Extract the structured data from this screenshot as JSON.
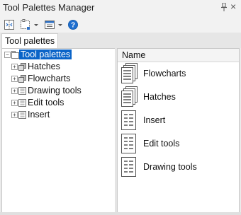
{
  "window": {
    "title": "Tool Palettes Manager",
    "pin_glyph": "⚓",
    "close_glyph": "×"
  },
  "toolbar": {
    "buttons": [
      {
        "name": "new-palette-icon",
        "dropdown": false
      },
      {
        "name": "import-icon",
        "dropdown": true
      },
      {
        "name": "view-options-icon",
        "dropdown": true
      },
      {
        "name": "help-icon",
        "dropdown": false
      }
    ],
    "help_glyph": "?"
  },
  "tabs": [
    {
      "label": "Tool palettes",
      "active": true
    }
  ],
  "tree": {
    "root": {
      "label": "Tool palettes",
      "expander": "−",
      "selected": true
    },
    "children": [
      {
        "label": "Hatches",
        "expander": "+",
        "icon": "stacked-palette-icon"
      },
      {
        "label": "Flowcharts",
        "expander": "+",
        "icon": "stacked-palette-icon"
      },
      {
        "label": "Drawing tools",
        "expander": "+",
        "icon": "palette-icon"
      },
      {
        "label": "Edit tools",
        "expander": "+",
        "icon": "palette-icon"
      },
      {
        "label": "Insert",
        "expander": "+",
        "icon": "palette-icon"
      }
    ]
  },
  "list": {
    "column_header": "Name",
    "items": [
      {
        "label": "Flowcharts",
        "icon": "stacked-palette-icon"
      },
      {
        "label": "Hatches",
        "icon": "stacked-palette-icon"
      },
      {
        "label": "Insert",
        "icon": "palette-icon"
      },
      {
        "label": "Edit tools",
        "icon": "palette-icon"
      },
      {
        "label": "Drawing tools",
        "icon": "palette-icon"
      }
    ]
  },
  "colors": {
    "selection": "#0a64c8",
    "help_blue": "#1e6fd0"
  }
}
